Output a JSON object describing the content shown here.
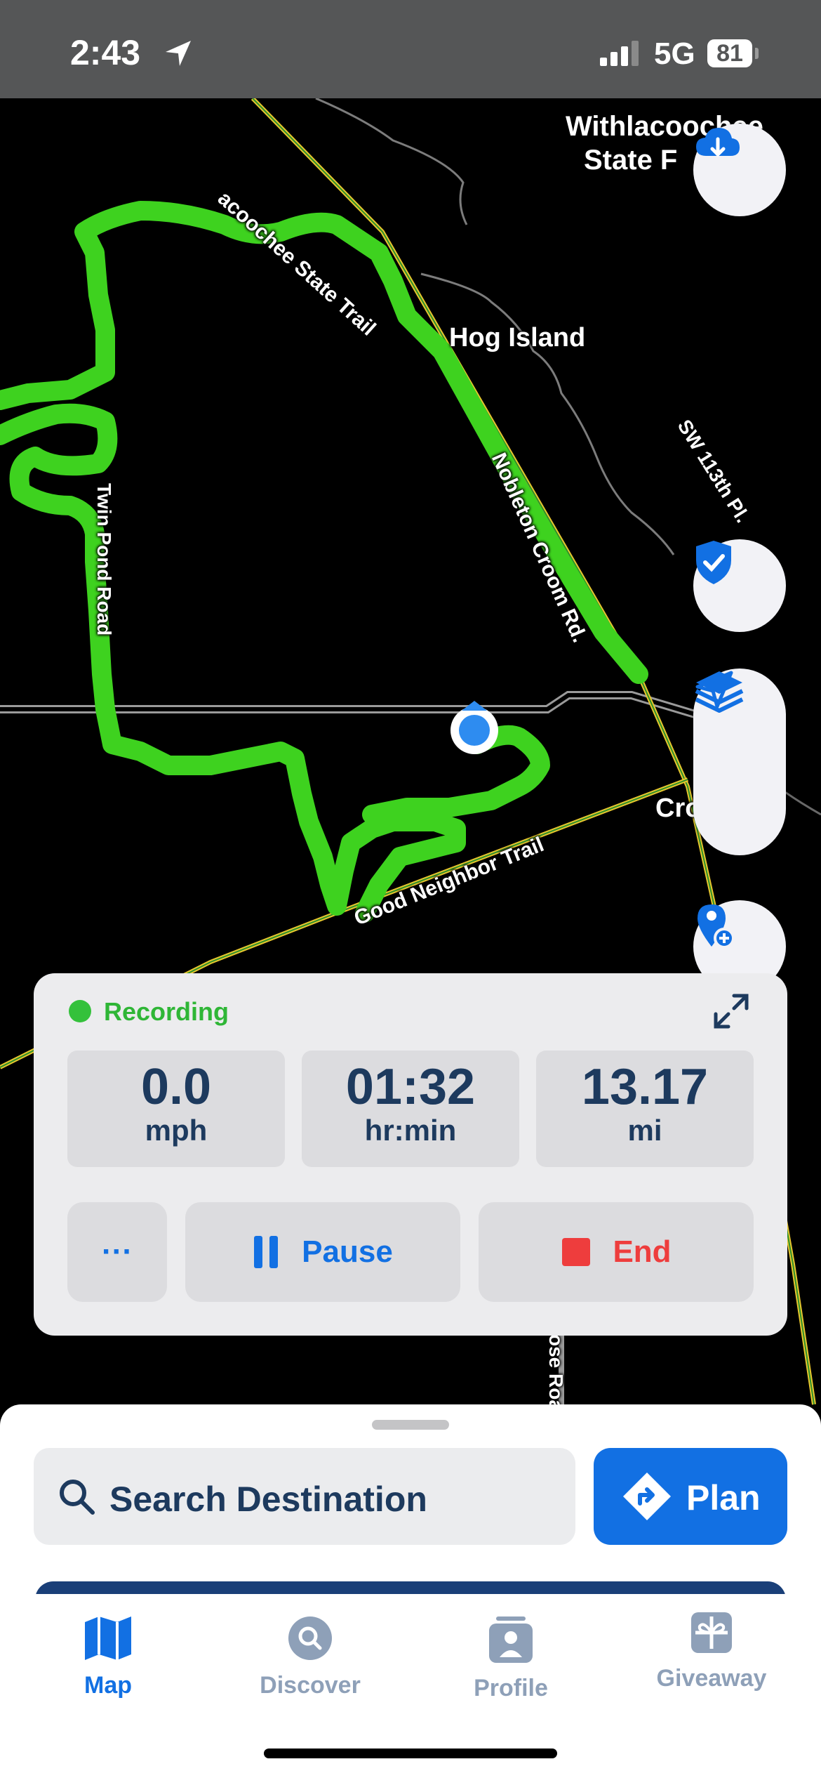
{
  "status_bar": {
    "time": "2:43",
    "network": "5G",
    "battery": "81"
  },
  "map": {
    "labels": {
      "state_forest_line1": "Withlacoochee",
      "state_forest_line2": "State F",
      "state_trail": "acoochee State Trail",
      "hog_island": "Hog Island",
      "sw_113th": "SW 113th Pl.",
      "nobleton_croom": "Nobleton Croom Rd.",
      "twin_pond": "Twin Pond Road",
      "cro": "Cro",
      "good_neighbor": "Good Neighbor Trail",
      "rose_road": "ose Roa"
    },
    "buttons": [
      "cloud-download",
      "shield-check",
      "layers",
      "navigation",
      "add-pin"
    ]
  },
  "recording": {
    "status": "Recording",
    "stats": [
      {
        "value": "0.0",
        "unit": "mph"
      },
      {
        "value": "01:32",
        "unit": "hr:min"
      },
      {
        "value": "13.17",
        "unit": "mi"
      }
    ],
    "more_label": "···",
    "pause_label": "Pause",
    "end_label": "End"
  },
  "sheet": {
    "search_placeholder": "Search Destination",
    "plan_label": "Plan"
  },
  "tabs": [
    {
      "label": "Map",
      "active": true
    },
    {
      "label": "Discover",
      "active": false
    },
    {
      "label": "Profile",
      "active": false
    },
    {
      "label": "Giveaway",
      "active": false
    }
  ],
  "colors": {
    "track_green": "#3ed21f",
    "accent_blue": "#1270e3",
    "recording_green": "#2fb636",
    "end_red": "#ee3d3d",
    "stat_text": "#1d3a5e"
  }
}
